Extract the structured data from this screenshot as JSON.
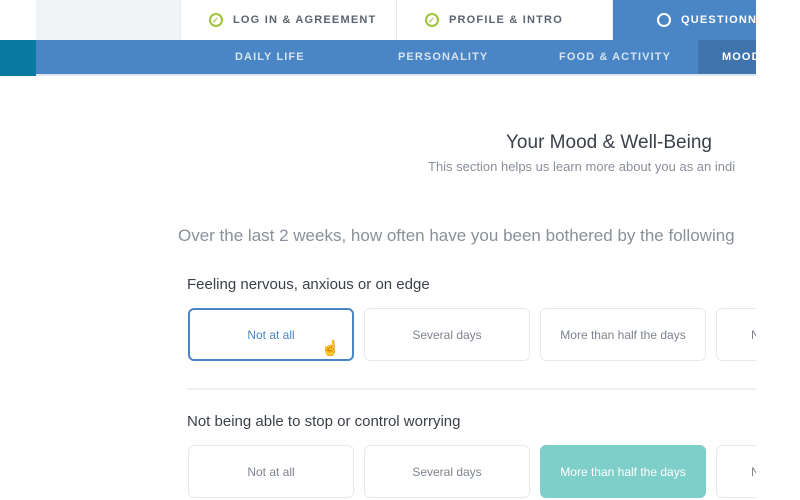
{
  "steps": [
    {
      "label": "LOG IN & AGREEMENT",
      "status": "complete",
      "icon": "check-circle-icon"
    },
    {
      "label": "PROFILE & INTRO",
      "status": "complete",
      "icon": "check-circle-icon"
    },
    {
      "label": "QUESTIONN",
      "status": "active",
      "icon": "circle-icon"
    }
  ],
  "subnav": [
    {
      "label": "DAILY LIFE"
    },
    {
      "label": "PERSONALITY"
    },
    {
      "label": "FOOD & ACTIVITY"
    },
    {
      "label": "MOOD",
      "active": true
    }
  ],
  "section": {
    "title": "Your Mood & Well-Being",
    "subtitle": "This section helps us learn more about you as an indi"
  },
  "prompt": "Over the last 2 weeks, how often have you been bothered by the following",
  "questions": [
    {
      "text": "Feeling nervous, anxious or on edge",
      "options": [
        "Not at all",
        "Several days",
        "More than half the days",
        "N"
      ],
      "selected": "Not at all"
    },
    {
      "text": "Not being able to stop or control worrying",
      "options": [
        "Not at all",
        "Several days",
        "More than half the days",
        "N"
      ],
      "selected": "More than half the days"
    }
  ],
  "colors": {
    "accent": "#4a86c5",
    "selected_fill": "#7ecfc9",
    "check": "#9cc33b"
  }
}
